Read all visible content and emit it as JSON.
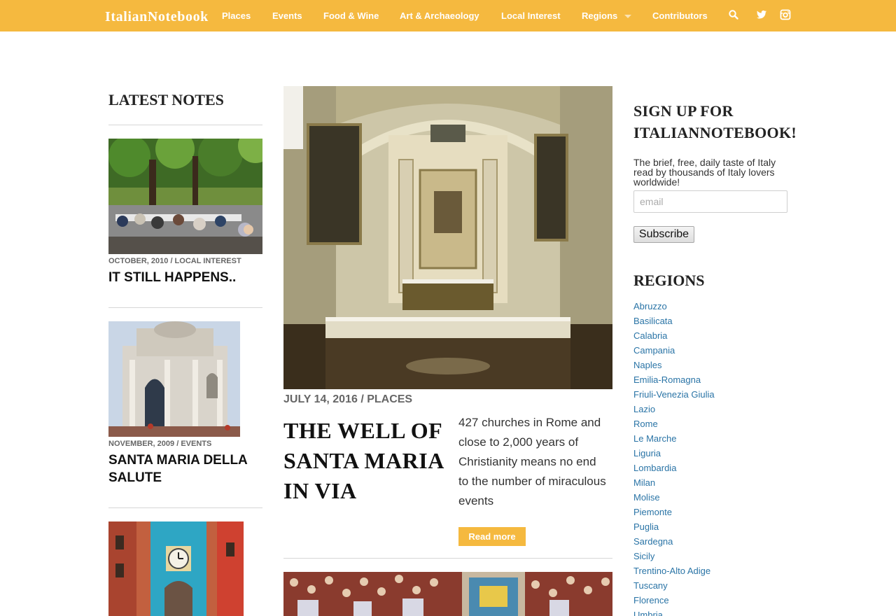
{
  "header": {
    "logo": "ItalianNotebook",
    "nav": [
      {
        "label": "Places"
      },
      {
        "label": "Events"
      },
      {
        "label": "Food & Wine"
      },
      {
        "label": "Art & Archaeology"
      },
      {
        "label": "Local Interest"
      },
      {
        "label": "Regions"
      },
      {
        "label": "Contributors"
      }
    ],
    "icons": [
      "search-icon",
      "twitter-icon",
      "instagram-icon"
    ]
  },
  "latest": {
    "title": "LATEST NOTES",
    "items": [
      {
        "meta": "OCTOBER, 2010 / LOCAL INTEREST",
        "title": "IT STILL HAPPENS.."
      },
      {
        "meta": "NOVEMBER, 2009 / EVENTS",
        "title": "SANTA MARIA DELLA SALUTE"
      }
    ]
  },
  "article": {
    "meta": "JULY 14, 2016 / PLACES",
    "title": "THE WELL OF SANTA MARIA IN VIA",
    "excerpt": "427 churches in Rome and close to 2,000 years of Christianity means no end to the number of miraculous events",
    "read_more": "Read more"
  },
  "signup": {
    "title": "SIGN UP FOR ITALIANNOTEBOOK!",
    "text": "The brief, free, daily taste of Italy read by thousands of Italy lovers worldwide!",
    "email_placeholder": "email",
    "subscribe": "Subscribe"
  },
  "regions": {
    "title": "REGIONS",
    "items": [
      "Abruzzo",
      "Basilicata",
      "Calabria",
      "Campania",
      "Naples",
      "Emilia-Romagna",
      "Friuli-Venezia Giulia",
      "Lazio",
      "Rome",
      "Le Marche",
      "Liguria",
      "Lombardia",
      "Milan",
      "Molise",
      "Piemonte",
      "Puglia",
      "Sardegna",
      "Sicily",
      "Trentino-Alto Adige",
      "Tuscany",
      "Florence",
      "Umbria"
    ]
  },
  "colors": {
    "accent": "#f5b93f",
    "link": "#2a74a6"
  }
}
